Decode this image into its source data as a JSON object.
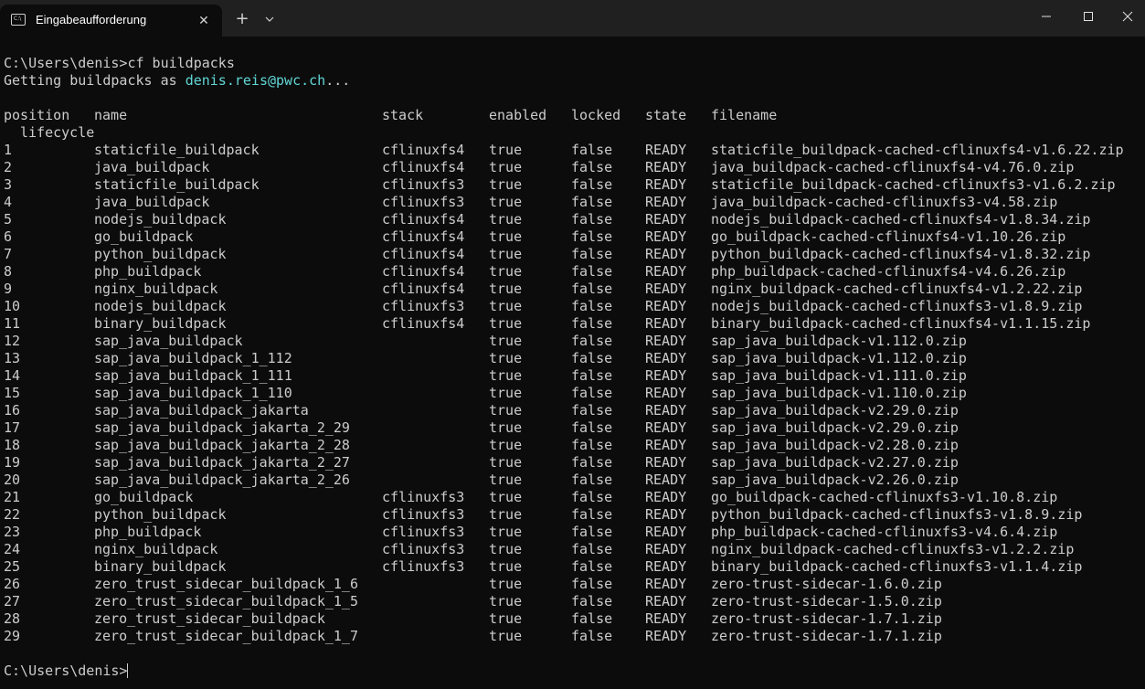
{
  "window": {
    "tab_title": "Eingabeaufforderung",
    "tab_icon": "cmd-icon",
    "new_tab_label": "+",
    "close_tab_label": "✕"
  },
  "console": {
    "command_prompt": "C:\\Users\\denis>",
    "command": "cf buildpacks",
    "getting_prefix": "Getting buildpacks as ",
    "user_email": "denis.reis@pwc.ch",
    "getting_suffix": "...",
    "headers": {
      "position": "position",
      "name": "name",
      "stack": "stack",
      "enabled": "enabled",
      "locked": "locked",
      "state": "state",
      "filename": "filename",
      "lifecycle": "lifecycle"
    },
    "rows": [
      {
        "position": "1",
        "name": "staticfile_buildpack",
        "stack": "cflinuxfs4",
        "enabled": "true",
        "locked": "false",
        "state": "READY",
        "filename": "staticfile_buildpack-cached-cflinuxfs4-v1.6.22.zip"
      },
      {
        "position": "2",
        "name": "java_buildpack",
        "stack": "cflinuxfs4",
        "enabled": "true",
        "locked": "false",
        "state": "READY",
        "filename": "java_buildpack-cached-cflinuxfs4-v4.76.0.zip"
      },
      {
        "position": "3",
        "name": "staticfile_buildpack",
        "stack": "cflinuxfs3",
        "enabled": "true",
        "locked": "false",
        "state": "READY",
        "filename": "staticfile_buildpack-cached-cflinuxfs3-v1.6.2.zip"
      },
      {
        "position": "4",
        "name": "java_buildpack",
        "stack": "cflinuxfs3",
        "enabled": "true",
        "locked": "false",
        "state": "READY",
        "filename": "java_buildpack-cached-cflinuxfs3-v4.58.zip"
      },
      {
        "position": "5",
        "name": "nodejs_buildpack",
        "stack": "cflinuxfs4",
        "enabled": "true",
        "locked": "false",
        "state": "READY",
        "filename": "nodejs_buildpack-cached-cflinuxfs4-v1.8.34.zip"
      },
      {
        "position": "6",
        "name": "go_buildpack",
        "stack": "cflinuxfs4",
        "enabled": "true",
        "locked": "false",
        "state": "READY",
        "filename": "go_buildpack-cached-cflinuxfs4-v1.10.26.zip"
      },
      {
        "position": "7",
        "name": "python_buildpack",
        "stack": "cflinuxfs4",
        "enabled": "true",
        "locked": "false",
        "state": "READY",
        "filename": "python_buildpack-cached-cflinuxfs4-v1.8.32.zip"
      },
      {
        "position": "8",
        "name": "php_buildpack",
        "stack": "cflinuxfs4",
        "enabled": "true",
        "locked": "false",
        "state": "READY",
        "filename": "php_buildpack-cached-cflinuxfs4-v4.6.26.zip"
      },
      {
        "position": "9",
        "name": "nginx_buildpack",
        "stack": "cflinuxfs4",
        "enabled": "true",
        "locked": "false",
        "state": "READY",
        "filename": "nginx_buildpack-cached-cflinuxfs4-v1.2.22.zip"
      },
      {
        "position": "10",
        "name": "nodejs_buildpack",
        "stack": "cflinuxfs3",
        "enabled": "true",
        "locked": "false",
        "state": "READY",
        "filename": "nodejs_buildpack-cached-cflinuxfs3-v1.8.9.zip"
      },
      {
        "position": "11",
        "name": "binary_buildpack",
        "stack": "cflinuxfs4",
        "enabled": "true",
        "locked": "false",
        "state": "READY",
        "filename": "binary_buildpack-cached-cflinuxfs4-v1.1.15.zip"
      },
      {
        "position": "12",
        "name": "sap_java_buildpack",
        "stack": "",
        "enabled": "true",
        "locked": "false",
        "state": "READY",
        "filename": "sap_java_buildpack-v1.112.0.zip"
      },
      {
        "position": "13",
        "name": "sap_java_buildpack_1_112",
        "stack": "",
        "enabled": "true",
        "locked": "false",
        "state": "READY",
        "filename": "sap_java_buildpack-v1.112.0.zip"
      },
      {
        "position": "14",
        "name": "sap_java_buildpack_1_111",
        "stack": "",
        "enabled": "true",
        "locked": "false",
        "state": "READY",
        "filename": "sap_java_buildpack-v1.111.0.zip"
      },
      {
        "position": "15",
        "name": "sap_java_buildpack_1_110",
        "stack": "",
        "enabled": "true",
        "locked": "false",
        "state": "READY",
        "filename": "sap_java_buildpack-v1.110.0.zip"
      },
      {
        "position": "16",
        "name": "sap_java_buildpack_jakarta",
        "stack": "",
        "enabled": "true",
        "locked": "false",
        "state": "READY",
        "filename": "sap_java_buildpack-v2.29.0.zip"
      },
      {
        "position": "17",
        "name": "sap_java_buildpack_jakarta_2_29",
        "stack": "",
        "enabled": "true",
        "locked": "false",
        "state": "READY",
        "filename": "sap_java_buildpack-v2.29.0.zip"
      },
      {
        "position": "18",
        "name": "sap_java_buildpack_jakarta_2_28",
        "stack": "",
        "enabled": "true",
        "locked": "false",
        "state": "READY",
        "filename": "sap_java_buildpack-v2.28.0.zip"
      },
      {
        "position": "19",
        "name": "sap_java_buildpack_jakarta_2_27",
        "stack": "",
        "enabled": "true",
        "locked": "false",
        "state": "READY",
        "filename": "sap_java_buildpack-v2.27.0.zip"
      },
      {
        "position": "20",
        "name": "sap_java_buildpack_jakarta_2_26",
        "stack": "",
        "enabled": "true",
        "locked": "false",
        "state": "READY",
        "filename": "sap_java_buildpack-v2.26.0.zip"
      },
      {
        "position": "21",
        "name": "go_buildpack",
        "stack": "cflinuxfs3",
        "enabled": "true",
        "locked": "false",
        "state": "READY",
        "filename": "go_buildpack-cached-cflinuxfs3-v1.10.8.zip"
      },
      {
        "position": "22",
        "name": "python_buildpack",
        "stack": "cflinuxfs3",
        "enabled": "true",
        "locked": "false",
        "state": "READY",
        "filename": "python_buildpack-cached-cflinuxfs3-v1.8.9.zip"
      },
      {
        "position": "23",
        "name": "php_buildpack",
        "stack": "cflinuxfs3",
        "enabled": "true",
        "locked": "false",
        "state": "READY",
        "filename": "php_buildpack-cached-cflinuxfs3-v4.6.4.zip"
      },
      {
        "position": "24",
        "name": "nginx_buildpack",
        "stack": "cflinuxfs3",
        "enabled": "true",
        "locked": "false",
        "state": "READY",
        "filename": "nginx_buildpack-cached-cflinuxfs3-v1.2.2.zip"
      },
      {
        "position": "25",
        "name": "binary_buildpack",
        "stack": "cflinuxfs3",
        "enabled": "true",
        "locked": "false",
        "state": "READY",
        "filename": "binary_buildpack-cached-cflinuxfs3-v1.1.4.zip"
      },
      {
        "position": "26",
        "name": "zero_trust_sidecar_buildpack_1_6",
        "stack": "",
        "enabled": "true",
        "locked": "false",
        "state": "READY",
        "filename": "zero-trust-sidecar-1.6.0.zip"
      },
      {
        "position": "27",
        "name": "zero_trust_sidecar_buildpack_1_5",
        "stack": "",
        "enabled": "true",
        "locked": "false",
        "state": "READY",
        "filename": "zero-trust-sidecar-1.5.0.zip"
      },
      {
        "position": "28",
        "name": "zero_trust_sidecar_buildpack",
        "stack": "",
        "enabled": "true",
        "locked": "false",
        "state": "READY",
        "filename": "zero-trust-sidecar-1.7.1.zip"
      },
      {
        "position": "29",
        "name": "zero_trust_sidecar_buildpack_1_7",
        "stack": "",
        "enabled": "true",
        "locked": "false",
        "state": "READY",
        "filename": "zero-trust-sidecar-1.7.1.zip"
      }
    ],
    "final_prompt": "C:\\Users\\denis>"
  },
  "colors": {
    "background": "#0c0c0c",
    "titlebar": "#202020",
    "text": "#cccccc",
    "email": "#61d6d6"
  }
}
